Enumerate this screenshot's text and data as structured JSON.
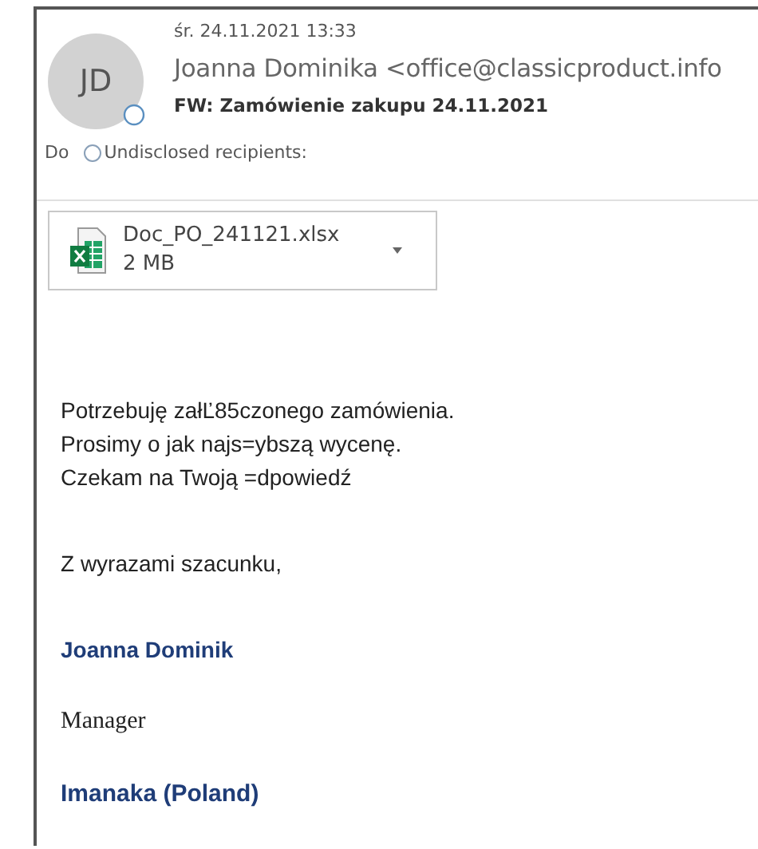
{
  "header": {
    "avatar_initials": "JD",
    "date": "śr. 24.11.2021 13:33",
    "sender": "Joanna Dominika <office@classicproduct.info",
    "subject": "FW: Zamówienie zakupu 24.11.2021",
    "to_label": "Do",
    "recipients": "Undisclosed recipients:"
  },
  "attachment": {
    "name": "Doc_PO_241121.xlsx",
    "size": "2 MB"
  },
  "body": {
    "lines": [
      "Potrzebuję załĽ85czonego zamówienia.",
      "Prosimy o jak najs=ybszą wycenę.",
      "Czekam na Twoją =dpowiedź"
    ],
    "closing": "Z wyrazami szacunku,",
    "signature": [
      {
        "kind": "name",
        "text": "Joanna Dominik"
      },
      {
        "kind": "title",
        "text": "Manager"
      },
      {
        "kind": "company",
        "text": "Imanaka (Poland)"
      }
    ]
  }
}
